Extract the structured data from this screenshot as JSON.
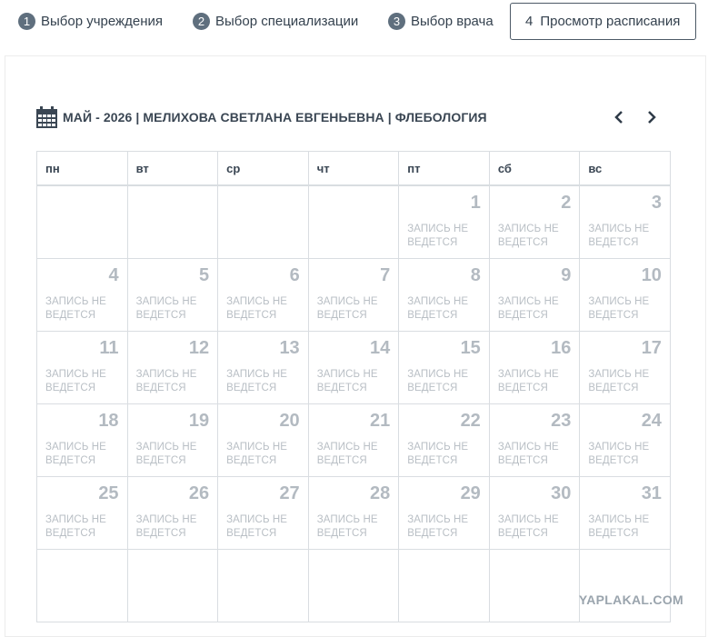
{
  "steps": [
    {
      "num": "1",
      "label": "Выбор учреждения"
    },
    {
      "num": "2",
      "label": "Выбор специализации"
    },
    {
      "num": "3",
      "label": "Выбор врача"
    },
    {
      "num": "4",
      "label": "Просмотр расписания"
    }
  ],
  "calendar": {
    "title": "МАЙ - 2026 | МЕЛИХОВА СВЕТЛАНА ЕВГЕНЬЕВНА | ФЛЕБОЛОГИЯ",
    "prev_icon": "chevron-left-icon",
    "next_icon": "chevron-right-icon",
    "weekdays": [
      "пн",
      "вт",
      "ср",
      "чт",
      "пт",
      "сб",
      "вс"
    ],
    "status_text": "ЗАПИСЬ НЕ ВЕДЕТСЯ",
    "weeks": [
      [
        "",
        "",
        "",
        "",
        "1",
        "2",
        "3"
      ],
      [
        "4",
        "5",
        "6",
        "7",
        "8",
        "9",
        "10"
      ],
      [
        "11",
        "12",
        "13",
        "14",
        "15",
        "16",
        "17"
      ],
      [
        "18",
        "19",
        "20",
        "21",
        "22",
        "23",
        "24"
      ],
      [
        "25",
        "26",
        "27",
        "28",
        "29",
        "30",
        "31"
      ],
      [
        "",
        "",
        "",
        "",
        "",
        "",
        ""
      ]
    ]
  },
  "watermark": "YAPLAKAL.COM"
}
